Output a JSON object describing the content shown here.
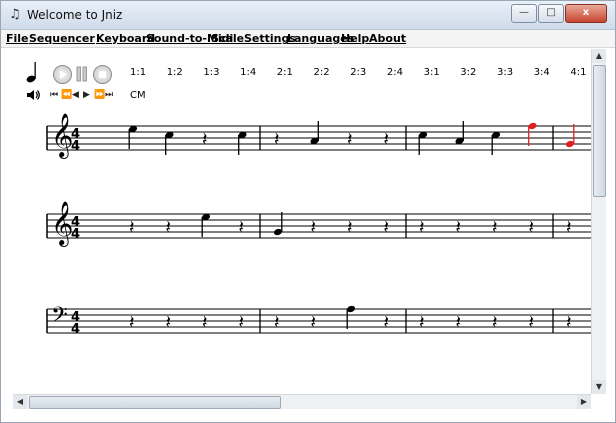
{
  "window": {
    "title": "Welcome to Jniz",
    "app_icon": "music-note-icon",
    "controls": {
      "minimize": "—",
      "maximize": "□",
      "close": "x"
    }
  },
  "menu": [
    {
      "label": "File"
    },
    {
      "label": "Sequencer"
    },
    {
      "label": "Keyboard"
    },
    {
      "label": "Sound-to-Midi"
    },
    {
      "label": "Scale"
    },
    {
      "label": "Settings"
    },
    {
      "label": "Languages"
    },
    {
      "label": "Help"
    },
    {
      "label": "About"
    }
  ],
  "toolbar": {
    "note_icon": "quarter-note-icon",
    "play_icon": "play-icon",
    "pause_icon": "pause-icon",
    "stop_icon": "stop-icon",
    "volume_icon": "speaker-icon",
    "ratios": [
      "1:1",
      "1:2",
      "1:3",
      "1:4",
      "2:1",
      "2:2",
      "2:3",
      "2:4",
      "3:1",
      "3:2",
      "3:3",
      "3:4",
      "4:1"
    ],
    "transport": [
      "⏮",
      "⏪",
      "◀",
      "▶",
      "⏩",
      "⏭"
    ],
    "scale_label": "CM"
  },
  "score": {
    "time_signature": [
      "4",
      "4"
    ],
    "accent_color": "#e02020",
    "staves": [
      {
        "clef": "treble",
        "measures": [
          [
            {
              "type": "note",
              "step": 3
            },
            {
              "type": "note",
              "step": 1
            },
            {
              "type": "rest"
            },
            {
              "type": "note",
              "step": 1
            }
          ],
          [
            {
              "type": "rest"
            },
            {
              "type": "note",
              "step": -1
            },
            {
              "type": "rest"
            },
            {
              "type": "rest"
            }
          ],
          [
            {
              "type": "note",
              "step": 1
            },
            {
              "type": "note",
              "step": -1
            },
            {
              "type": "note",
              "step": 1
            },
            {
              "type": "note",
              "step": 4,
              "red": true
            }
          ],
          [
            {
              "type": "note",
              "step": -2,
              "red": true
            }
          ]
        ]
      },
      {
        "clef": "treble",
        "measures": [
          [
            {
              "type": "rest"
            },
            {
              "type": "rest"
            },
            {
              "type": "note",
              "step": 3
            },
            {
              "type": "rest"
            }
          ],
          [
            {
              "type": "note",
              "step": -2
            },
            {
              "type": "rest"
            },
            {
              "type": "rest"
            },
            {
              "type": "rest"
            }
          ],
          [
            {
              "type": "rest"
            },
            {
              "type": "rest"
            },
            {
              "type": "rest"
            },
            {
              "type": "rest"
            }
          ],
          [
            {
              "type": "rest"
            }
          ]
        ]
      },
      {
        "clef": "bass",
        "measures": [
          [
            {
              "type": "rest"
            },
            {
              "type": "rest"
            },
            {
              "type": "rest"
            },
            {
              "type": "rest"
            }
          ],
          [
            {
              "type": "rest"
            },
            {
              "type": "rest"
            },
            {
              "type": "note",
              "step": 4
            },
            {
              "type": "rest"
            }
          ],
          [
            {
              "type": "rest"
            },
            {
              "type": "rest"
            },
            {
              "type": "rest"
            },
            {
              "type": "rest"
            }
          ],
          [
            {
              "type": "rest"
            }
          ]
        ]
      }
    ]
  }
}
